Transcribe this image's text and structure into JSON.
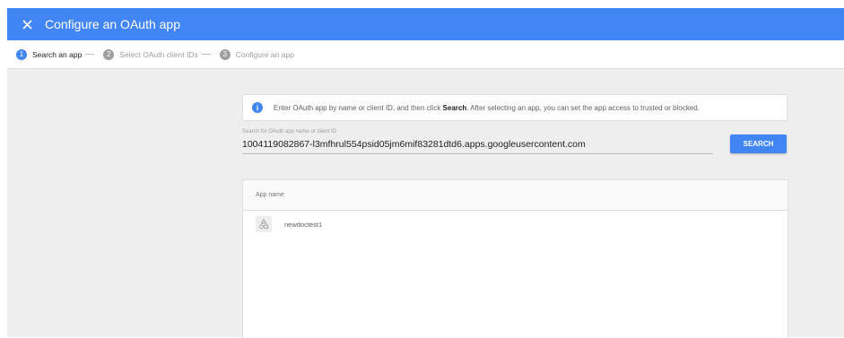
{
  "header": {
    "title": "Configure an OAuth app",
    "close_icon": "close-icon",
    "bg_color": "#4285f4"
  },
  "stepper": {
    "steps": [
      {
        "number": "1",
        "label": "Search an app",
        "state": "active"
      },
      {
        "number": "2",
        "label": "Select OAuth client IDs",
        "state": "inactive"
      },
      {
        "number": "3",
        "label": "Configure an app",
        "state": "inactive"
      }
    ]
  },
  "info": {
    "icon": "info-icon",
    "text_before": "Enter OAuth app by name or client ID, and then click ",
    "text_bold": "Search",
    "text_after": ". After selecting an app, you can set the app access to trusted or blocked."
  },
  "search": {
    "label": "Search for OAuth app name or client ID",
    "value": "1004119082867-l3mfhrul554psid05jm6mif83281dtd6.apps.googleusercontent.com",
    "button_label": "SEARCH"
  },
  "results": {
    "column_header": "App name",
    "rows": [
      {
        "name": "newdoctest1",
        "icon": "app-shapes-icon"
      }
    ]
  }
}
